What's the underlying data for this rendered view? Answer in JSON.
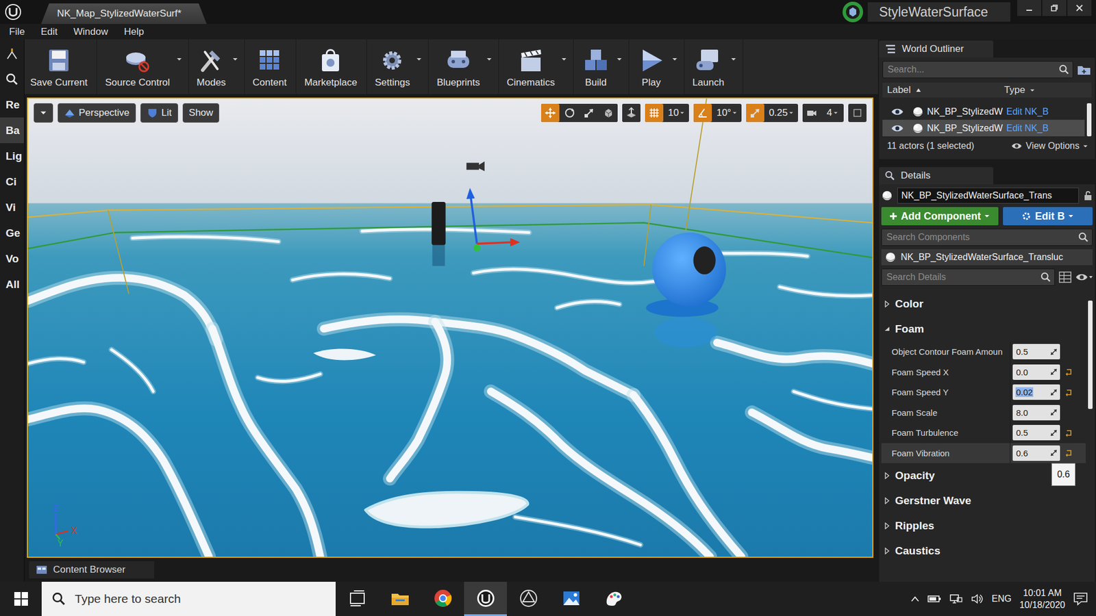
{
  "window": {
    "tab_title": "NK_Map_StylizedWaterSurf*",
    "project": "StyleWaterSurface"
  },
  "menu": [
    "File",
    "Edit",
    "Window",
    "Help"
  ],
  "toolbar": [
    {
      "label": "Save Current",
      "kind": "save",
      "dropdown": false
    },
    {
      "label": "Source Control",
      "kind": "source",
      "dropdown": true
    },
    {
      "label": "Modes",
      "kind": "modes",
      "dropdown": true
    },
    {
      "label": "Content",
      "kind": "content",
      "dropdown": false
    },
    {
      "label": "Marketplace",
      "kind": "marketplace",
      "dropdown": false
    },
    {
      "label": "Settings",
      "kind": "settings",
      "dropdown": true
    },
    {
      "label": "Blueprints",
      "kind": "blueprints",
      "dropdown": true
    },
    {
      "label": "Cinematics",
      "kind": "cinematics",
      "dropdown": true
    },
    {
      "label": "Build",
      "kind": "build",
      "dropdown": true
    },
    {
      "label": "Play",
      "kind": "play",
      "dropdown": true
    },
    {
      "label": "Launch",
      "kind": "launch",
      "dropdown": true
    }
  ],
  "modes_strip": [
    {
      "label": "Re",
      "selected": false
    },
    {
      "label": "Ba",
      "selected": true
    },
    {
      "label": "Lig",
      "selected": false
    },
    {
      "label": "Ci",
      "selected": false
    },
    {
      "label": "Vi",
      "selected": false
    },
    {
      "label": "Ge",
      "selected": false
    },
    {
      "label": "Vo",
      "selected": false
    },
    {
      "label": "All",
      "selected": false
    }
  ],
  "viewport": {
    "selected": true,
    "view_buttons": [
      {
        "label": "Perspective",
        "kind": "perspective"
      },
      {
        "label": "Lit",
        "kind": "lit"
      },
      {
        "label": "Show",
        "kind": "show"
      }
    ],
    "transform_modes": [
      {
        "kind": "translate",
        "selected": true
      },
      {
        "kind": "rotate",
        "selected": false
      },
      {
        "kind": "scale",
        "selected": false
      },
      {
        "kind": "space",
        "selected": false
      }
    ],
    "snaps": [
      {
        "kind": "surface",
        "value": "",
        "on": false
      },
      {
        "kind": "grid",
        "value": "10",
        "on": true
      },
      {
        "kind": "angle",
        "value": "10°",
        "on": true
      },
      {
        "kind": "scale",
        "value": "0.25",
        "on": true
      },
      {
        "kind": "camera",
        "value": "4",
        "on": false
      }
    ],
    "axis": [
      "Z",
      "Y",
      "X"
    ]
  },
  "outliner": {
    "title": "World Outliner",
    "search_placeholder": "Search...",
    "columns": [
      "Label",
      "Type"
    ],
    "rows": [
      {
        "label": "NK_BP_StylizedW",
        "type": "Edit NK_B",
        "selected": false
      },
      {
        "label": "NK_BP_StylizedW",
        "type": "Edit NK_B",
        "selected": true
      }
    ],
    "status": "11 actors (1 selected)",
    "view_options": "View Options"
  },
  "details": {
    "title": "Details",
    "actor_name": "NK_BP_StylizedWaterSurface_Trans",
    "add_component": "Add Component",
    "edit_blueprint": "Edit B",
    "component_search_placeholder": "Search Components",
    "component": "NK_BP_StylizedWaterSurface_Transluc",
    "details_search_placeholder": "Search Details",
    "categories": [
      {
        "name": "Color",
        "expanded": false,
        "properties": []
      },
      {
        "name": "Foam",
        "expanded": true,
        "properties": [
          {
            "name": "Object Contour Foam Amoun",
            "value": "0.5",
            "modified": false,
            "editing": false,
            "hovered": false
          },
          {
            "name": "Foam Speed X",
            "value": "0.0",
            "modified": true,
            "editing": false,
            "hovered": false
          },
          {
            "name": "Foam Speed Y",
            "value": "0.02",
            "modified": true,
            "editing": true,
            "hovered": false
          },
          {
            "name": "Foam Scale",
            "value": "8.0",
            "modified": false,
            "editing": false,
            "hovered": false
          },
          {
            "name": "Foam Turbulence",
            "value": "0.5",
            "modified": true,
            "editing": false,
            "hovered": false
          },
          {
            "name": "Foam Vibration",
            "value": "0.6",
            "modified": true,
            "editing": false,
            "hovered": true
          }
        ]
      },
      {
        "name": "Opacity",
        "expanded": false,
        "properties": []
      },
      {
        "name": "Gerstner Wave",
        "expanded": false,
        "properties": []
      },
      {
        "name": "Ripples",
        "expanded": false,
        "properties": []
      },
      {
        "name": "Caustics",
        "expanded": false,
        "properties": []
      }
    ],
    "tooltip": "0.6"
  },
  "bottom_tabs": [
    "Content Browser"
  ],
  "taskbar": {
    "search_placeholder": "Type here to search",
    "apps": [
      {
        "kind": "taskview",
        "active": false
      },
      {
        "kind": "explorer",
        "active": false
      },
      {
        "kind": "chrome",
        "active": false
      },
      {
        "kind": "unreal",
        "active": true
      },
      {
        "kind": "unity",
        "active": false
      },
      {
        "kind": "photos",
        "active": false
      },
      {
        "kind": "paint",
        "active": false
      }
    ],
    "language": "ENG",
    "time": "10:01 AM",
    "date": "10/18/2020"
  }
}
